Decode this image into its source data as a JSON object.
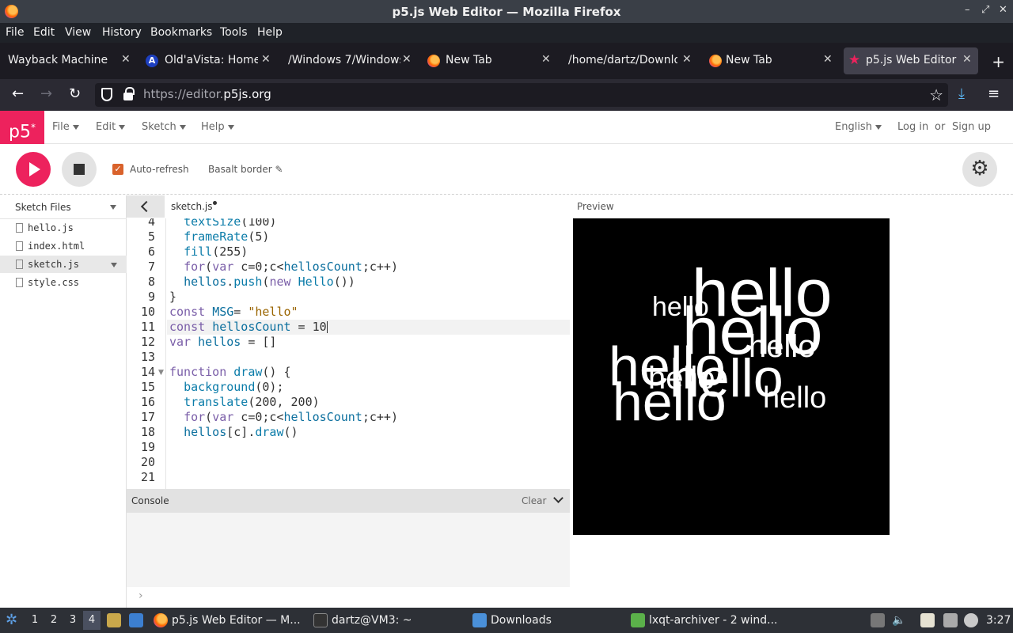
{
  "window": {
    "title": "p5.js Web Editor — Mozilla Firefox",
    "controls": [
      "–",
      "⤢",
      "✕"
    ]
  },
  "menubar": [
    "File",
    "Edit",
    "View",
    "History",
    "Bookmarks",
    "Tools",
    "Help"
  ],
  "tabs": [
    {
      "label": "Wayback Machine",
      "icon": "none"
    },
    {
      "label": "Old'aVista: Home",
      "icon": "altavista-icon"
    },
    {
      "label": "/Windows 7/Windows",
      "icon": "none"
    },
    {
      "label": "New Tab",
      "icon": "firefox-icon"
    },
    {
      "label": "/home/dartz/Downloa",
      "icon": "none"
    },
    {
      "label": "New Tab",
      "icon": "firefox-icon"
    },
    {
      "label": "p5.js Web Editor",
      "icon": "p5-star-icon",
      "active": true
    }
  ],
  "new_tab_label": "+",
  "tab_close_glyph": "✕",
  "nav": {
    "url_prefix": "https://editor.",
    "url_domain": "p5js.org"
  },
  "p5": {
    "logo": "p5",
    "logo_sup": "*",
    "menu": [
      "File",
      "Edit",
      "Sketch",
      "Help"
    ],
    "language": "English",
    "login": "Log in",
    "or": "or",
    "signup": "Sign up"
  },
  "toolbar": {
    "auto_refresh_label": "Auto-refresh",
    "auto_refresh_checked": true,
    "sketch_name": "Basalt border ✎"
  },
  "sidebar": {
    "title": "Sketch Files",
    "files": [
      "hello.js",
      "index.html",
      "sketch.js",
      "style.css"
    ],
    "selected": "sketch.js"
  },
  "editor": {
    "tab_name": "sketch.js",
    "line_numbers": [
      "4",
      "5",
      "6",
      "7",
      "8",
      "9",
      "10",
      "11",
      "12",
      "13",
      "14",
      "15",
      "16",
      "17",
      "18",
      "19",
      "20",
      "21"
    ],
    "lines": [
      "  textSize(100)",
      "  frameRate(5)",
      "  fill(255)",
      "  for(var c=0;c<hellosCount;c++)",
      "  hellos.push(new Hello())",
      "}",
      "const MSG= \"hello\"",
      "const hellosCount = 10",
      "var hellos = []",
      "",
      "function draw() {",
      "  background(0);",
      "  translate(200, 200)",
      "  for(var c=0;c<hellosCount;c++)",
      "  hellos[c].draw()",
      "",
      "",
      ""
    ],
    "active_line": "11"
  },
  "console": {
    "title": "Console",
    "clear_label": "Clear",
    "prompt": "›"
  },
  "preview": {
    "label": "Preview",
    "word": "hello"
  },
  "taskbar": {
    "desktops": [
      "1",
      "2",
      "3",
      "4"
    ],
    "active_desktop": "4",
    "items": [
      "p5.js Web Editor — M...",
      "dartz@VM3: ~",
      "Downloads",
      "lxqt-archiver - 2 wind..."
    ],
    "clock": "3:27"
  },
  "colors": {
    "p5_pink": "#ed225d",
    "autorefresh_orange": "#d9622b"
  }
}
